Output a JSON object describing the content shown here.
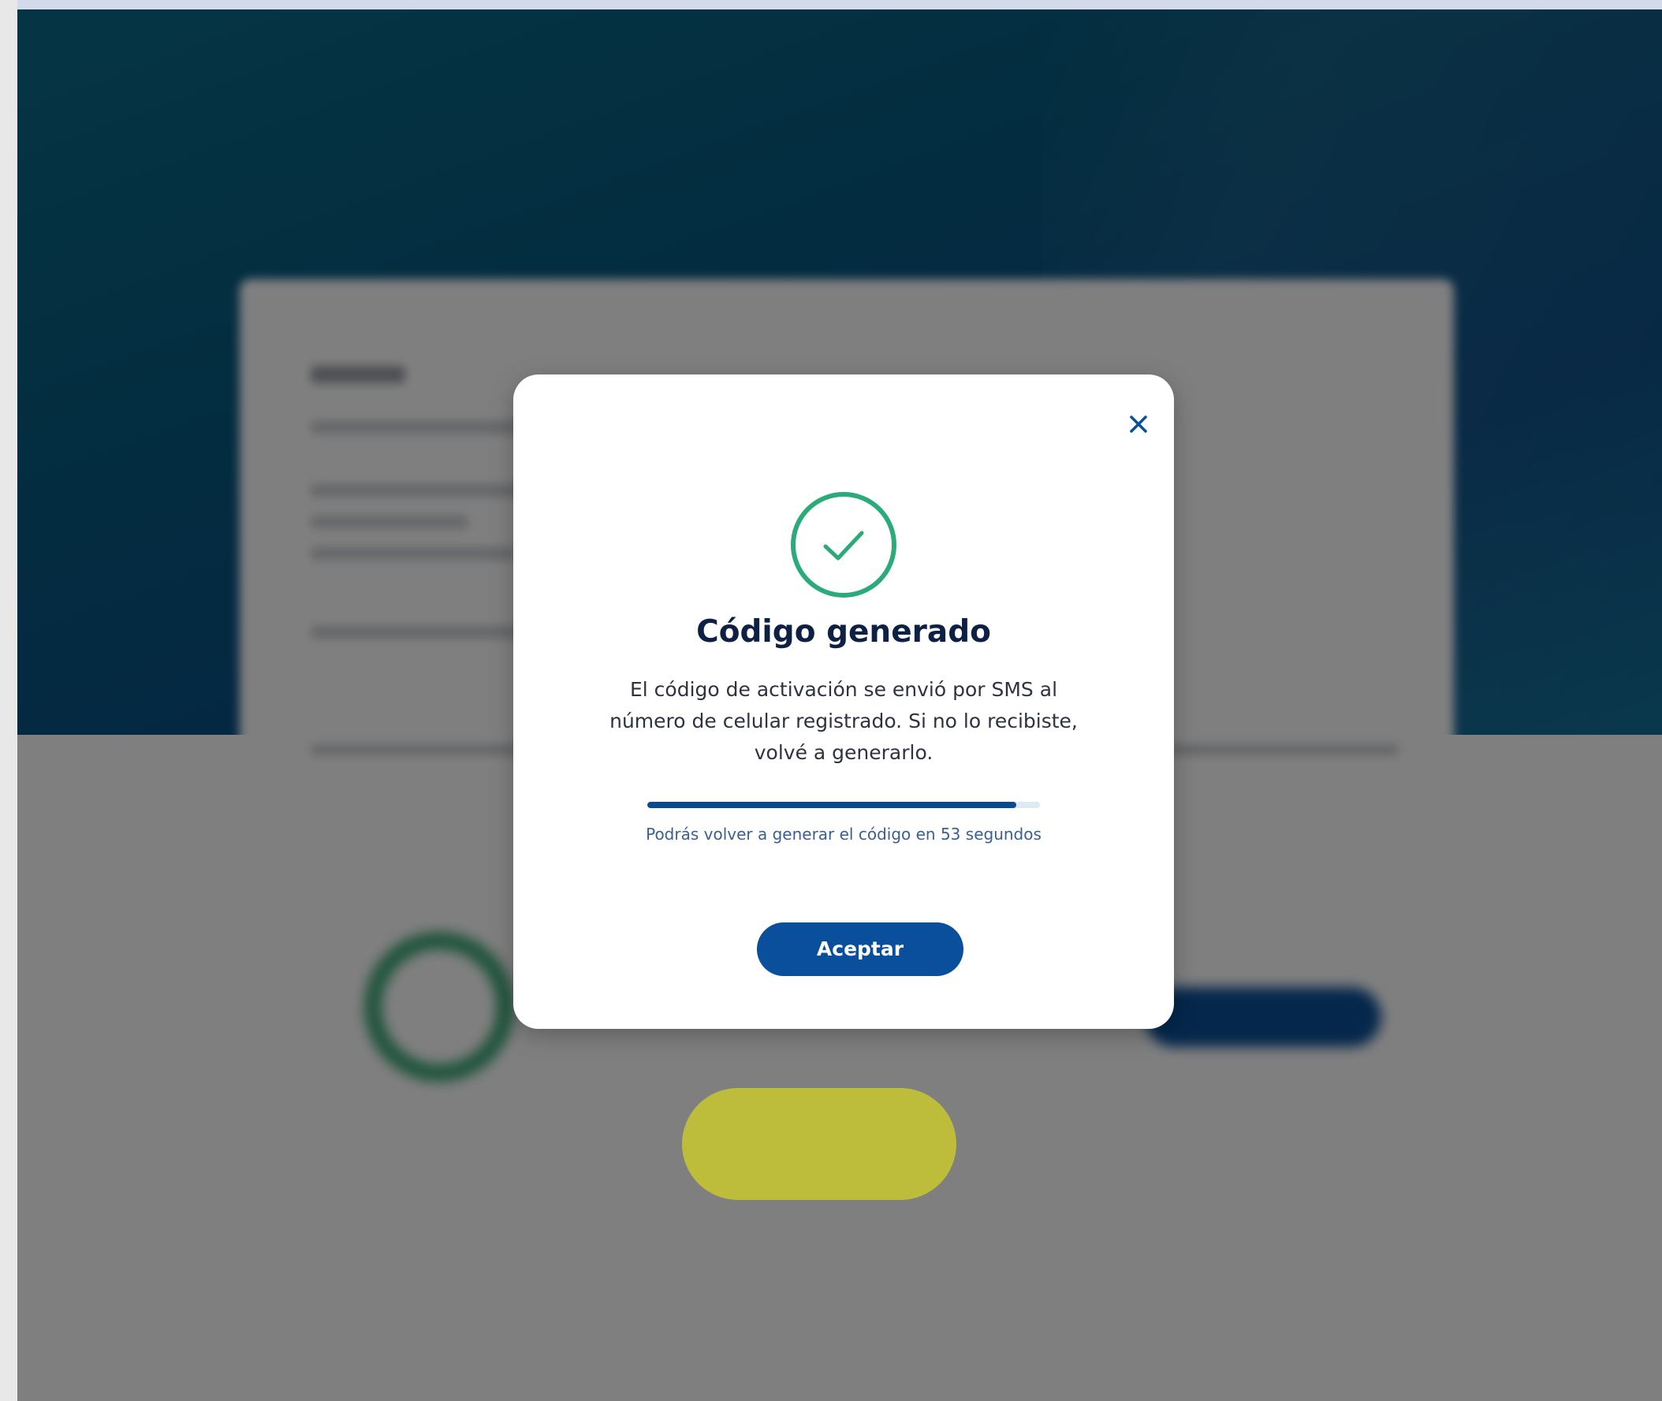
{
  "modal": {
    "title": "Código generado",
    "message": "El código de activación se envió por SMS al número de celular registrado. Si no lo recibiste, volvé a generarlo.",
    "countdown_text": "Podrás volver a generar el código en 53 segundos",
    "accept_label": "Aceptar",
    "close_icon": "close-icon",
    "status_icon": "check-circle-icon",
    "progress": 0.94
  },
  "colors": {
    "primary": "#0a4f9c",
    "success": "#2bab7a",
    "title": "#0e2044",
    "hero": "#075a80",
    "highlight": "#bdbd3b"
  }
}
